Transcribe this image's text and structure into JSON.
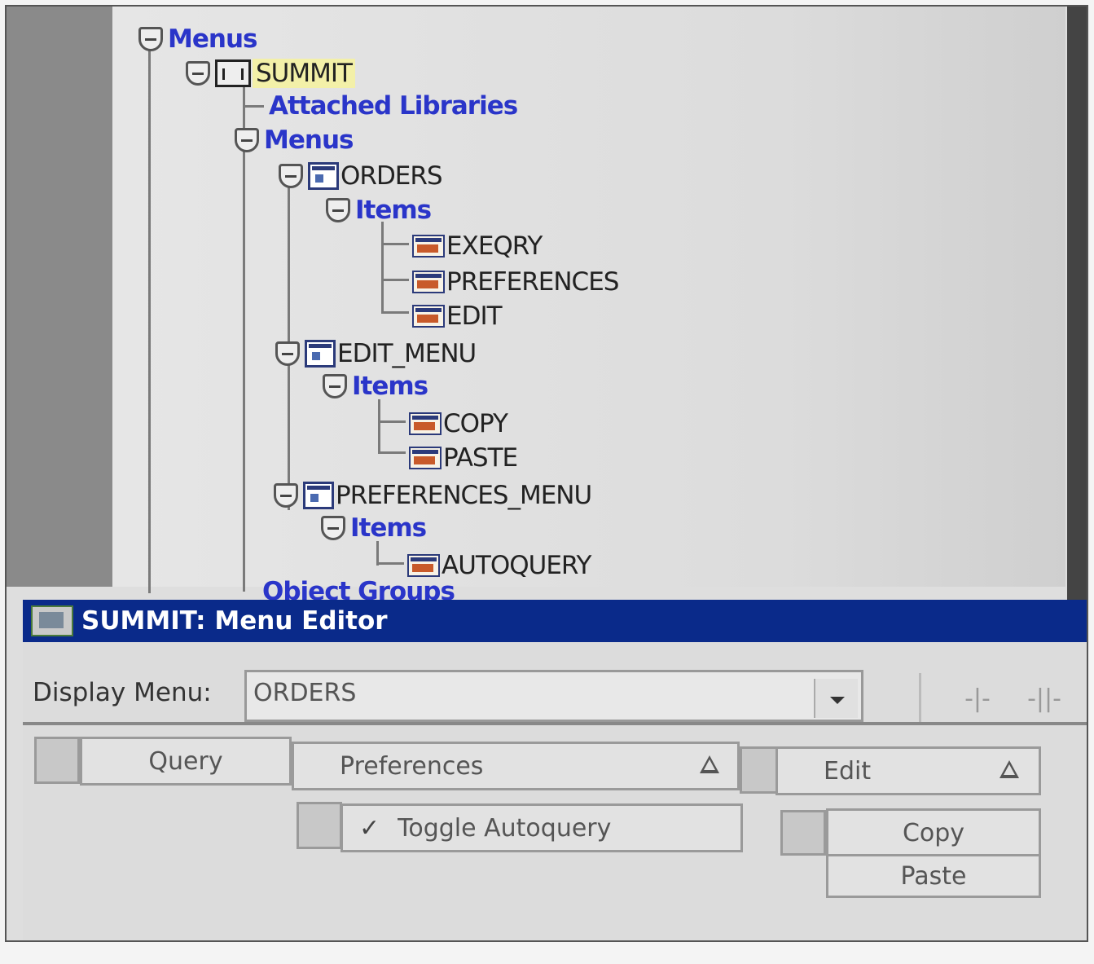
{
  "tree": {
    "root_label": "Menus",
    "module_label": "SUMMIT",
    "attached_libraries_label": "Attached Libraries",
    "menus_label": "Menus",
    "menus": [
      {
        "label": "ORDERS",
        "items_label": "Items",
        "items": [
          "EXEQRY",
          "PREFERENCES",
          "EDIT"
        ]
      },
      {
        "label": "EDIT_MENU",
        "items_label": "Items",
        "items": [
          "COPY",
          "PASTE"
        ]
      },
      {
        "label": "PREFERENCES_MENU",
        "items_label": "Items",
        "items": [
          "AUTOQUERY"
        ]
      }
    ],
    "cut_off_label": "Object Groups"
  },
  "editor": {
    "title": "SUMMIT: Menu Editor",
    "display_menu_label": "Display Menu:",
    "display_menu_value": "ORDERS",
    "menu_bar": {
      "items": [
        "Query",
        "Preferences",
        "Edit"
      ]
    },
    "preferences_submenu": [
      "Toggle Autoquery"
    ],
    "preferences_checked": "✓",
    "edit_submenu": [
      "Copy",
      "Paste"
    ]
  }
}
